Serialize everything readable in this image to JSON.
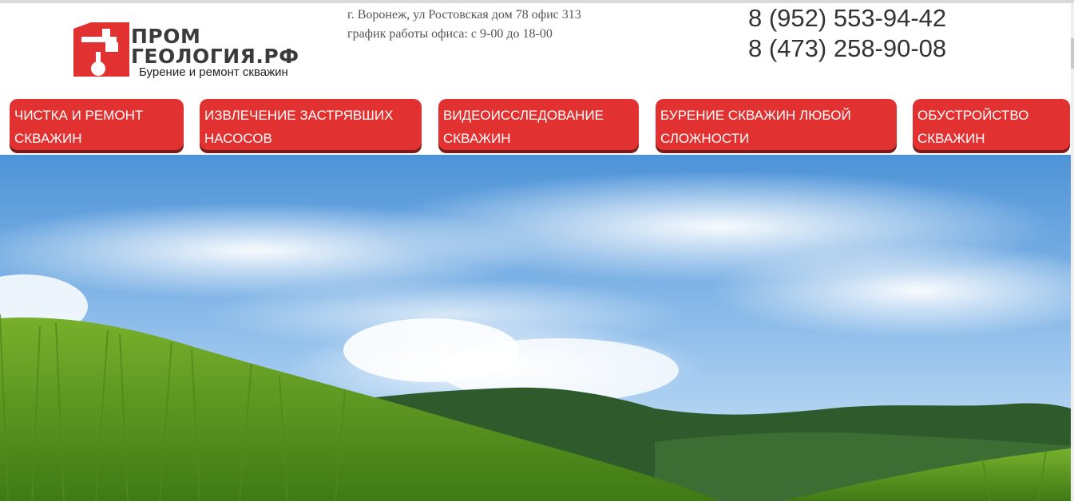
{
  "logo": {
    "word1": "ПРОМ",
    "word2": "ГЕОЛОГИЯ.РФ",
    "tagline": "Бурение и ремонт скважин",
    "brand_color": "#e23131",
    "icon": "drill-rig-logo-icon"
  },
  "contact": {
    "address": "г. Воронеж, ул Ростовская дом 78 офис 313",
    "hours": "график работы офиса: с 9-00 до 18-00",
    "phone1": "8 (952) 553-94-42",
    "phone2": "8 (473) 258-90-08"
  },
  "nav": {
    "button_color": "#e23131",
    "items": [
      {
        "label": "Чистка и ремонт скважин"
      },
      {
        "label": "Извлечение застрявших насосов"
      },
      {
        "label": "Видеоисследование скважин"
      },
      {
        "label": "Бурение скважин любой сложности"
      },
      {
        "label": "Обустройство скважин"
      }
    ]
  },
  "hero": {
    "image": "sky-hills-grass-landscape",
    "colors": {
      "sky": "#5ea0de",
      "hills": "#2f5b2c",
      "grass": "#5f9a1e"
    }
  }
}
